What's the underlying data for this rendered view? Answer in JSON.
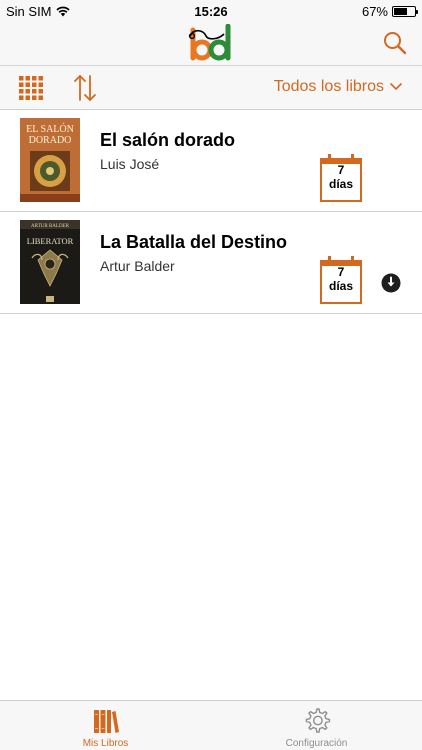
{
  "status_bar": {
    "carrier": "Sin SIM",
    "time": "15:26",
    "battery": "67%",
    "battery_level": 0.67
  },
  "nav": {
    "logo_icon": "bd-logo-icon",
    "search_icon": "search-icon"
  },
  "toolbar": {
    "grid_icon": "grid-view-icon",
    "sort_icon": "sort-arrows-icon",
    "filter_label": "Todos los libros"
  },
  "books": [
    {
      "title": "El salón dorado",
      "author": "Luis José",
      "loan_days_number": "7",
      "loan_days_unit": "días",
      "downloadable": false
    },
    {
      "title": "La Batalla del Destino",
      "author": "Artur Balder",
      "loan_days_number": "7",
      "loan_days_unit": "días",
      "downloadable": true
    }
  ],
  "tabs": [
    {
      "label": "Mis Libros",
      "icon": "books-icon",
      "selected": true
    },
    {
      "label": "Configuración",
      "icon": "gear-icon",
      "selected": false
    }
  ],
  "colors": {
    "accent": "#d2691e",
    "logo_orange": "#e87722",
    "logo_green": "#2e8b3a"
  }
}
